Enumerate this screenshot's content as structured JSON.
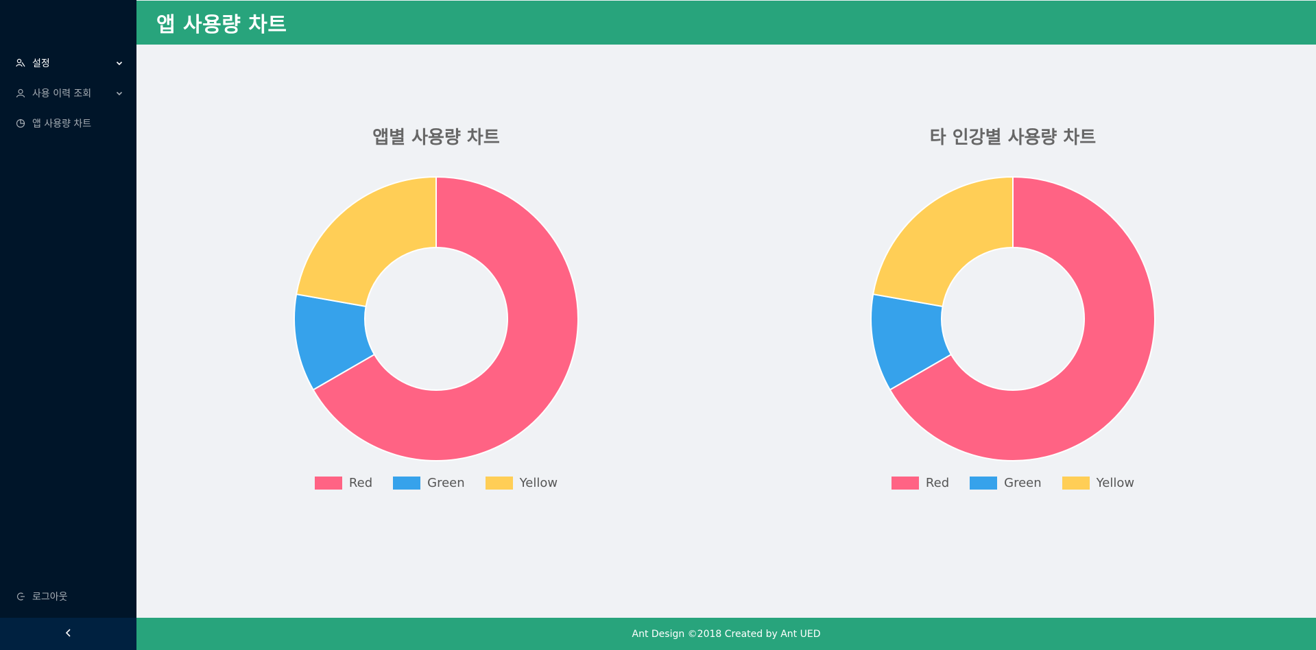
{
  "header": {
    "title": "앱 사용량 차트"
  },
  "sidebar": {
    "items": [
      {
        "label": "설정",
        "icon": "settings-users-icon"
      },
      {
        "label": "사용 이력 조회",
        "icon": "user-icon"
      },
      {
        "label": "앱 사용량 차트",
        "icon": "pie-chart-icon"
      }
    ],
    "logout": {
      "label": "로그아웃",
      "icon": "logout-icon"
    },
    "collapse_icon": "chevron-left-icon"
  },
  "footer": {
    "text": "Ant Design ©2018 Created by Ant UED"
  },
  "colors": {
    "red": "#ff6384",
    "green": "#36a2eb",
    "yellow": "#ffce56",
    "header": "#28a47c",
    "sider": "#001529"
  },
  "chart_data": [
    {
      "type": "pie",
      "title": "앱별 사용량 차트",
      "categories": [
        "Red",
        "Green",
        "Yellow"
      ],
      "values": [
        300,
        50,
        100
      ],
      "colors": [
        "#ff6384",
        "#36a2eb",
        "#ffce56"
      ],
      "legend": "bottom"
    },
    {
      "type": "pie",
      "title": "타 인강별 사용량 차트",
      "categories": [
        "Red",
        "Green",
        "Yellow"
      ],
      "values": [
        300,
        50,
        100
      ],
      "colors": [
        "#ff6384",
        "#36a2eb",
        "#ffce56"
      ],
      "legend": "bottom"
    }
  ]
}
